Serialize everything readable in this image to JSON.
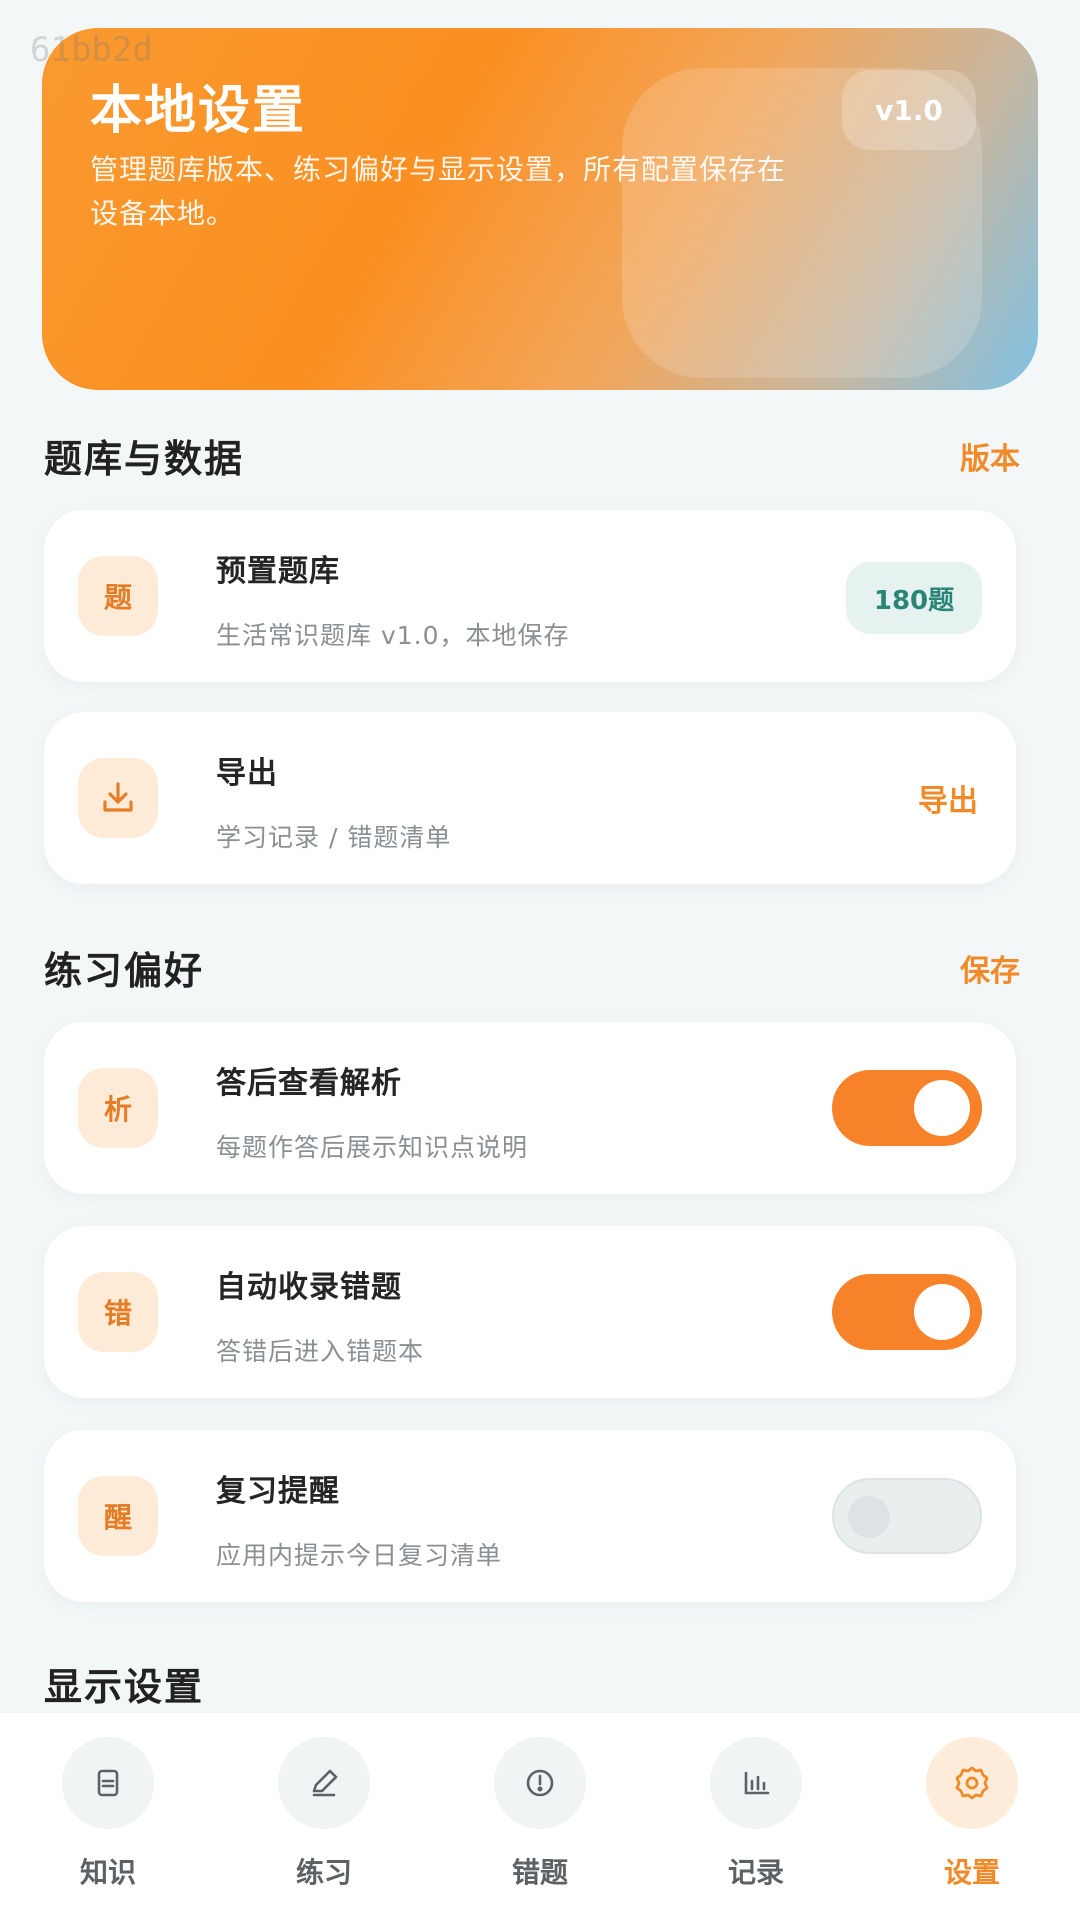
{
  "watermark": "61bb2d",
  "hero": {
    "title": "本地设置",
    "desc": "管理题库版本、练习偏好与显示设置，所有配置保存在设备本地。",
    "version": "v1.0"
  },
  "sections": {
    "bank": {
      "title": "题库与数据",
      "action": "版本"
    },
    "practice": {
      "title": "练习偏好",
      "action": "保存"
    },
    "display": {
      "title": "显示设置"
    }
  },
  "cards": {
    "preset": {
      "icon": "题",
      "title": "预置题库",
      "sub": "生活常识题库 v1.0，本地保存",
      "badge": "180题"
    },
    "export": {
      "icon_name": "download-icon",
      "title": "导出",
      "sub": "学习记录 / 错题清单",
      "action": "导出"
    },
    "analysis": {
      "icon": "析",
      "title": "答后查看解析",
      "sub": "每题作答后展示知识点说明",
      "enabled": true
    },
    "wrong": {
      "icon": "错",
      "title": "自动收录错题",
      "sub": "答错后进入错题本",
      "enabled": true
    },
    "remind": {
      "icon": "醒",
      "title": "复习提醒",
      "sub": "应用内提示今日复习清单",
      "enabled": false
    }
  },
  "tabs": [
    {
      "label": "知识",
      "icon": "document-icon",
      "active": false
    },
    {
      "label": "练习",
      "icon": "pencil-icon",
      "active": false
    },
    {
      "label": "错题",
      "icon": "alert-circle-icon",
      "active": false
    },
    {
      "label": "记录",
      "icon": "bar-chart-icon",
      "active": false
    },
    {
      "label": "设置",
      "icon": "gear-icon",
      "active": true
    }
  ],
  "colors": {
    "accent": "#f7822a",
    "badge_green": "#2a8577"
  }
}
